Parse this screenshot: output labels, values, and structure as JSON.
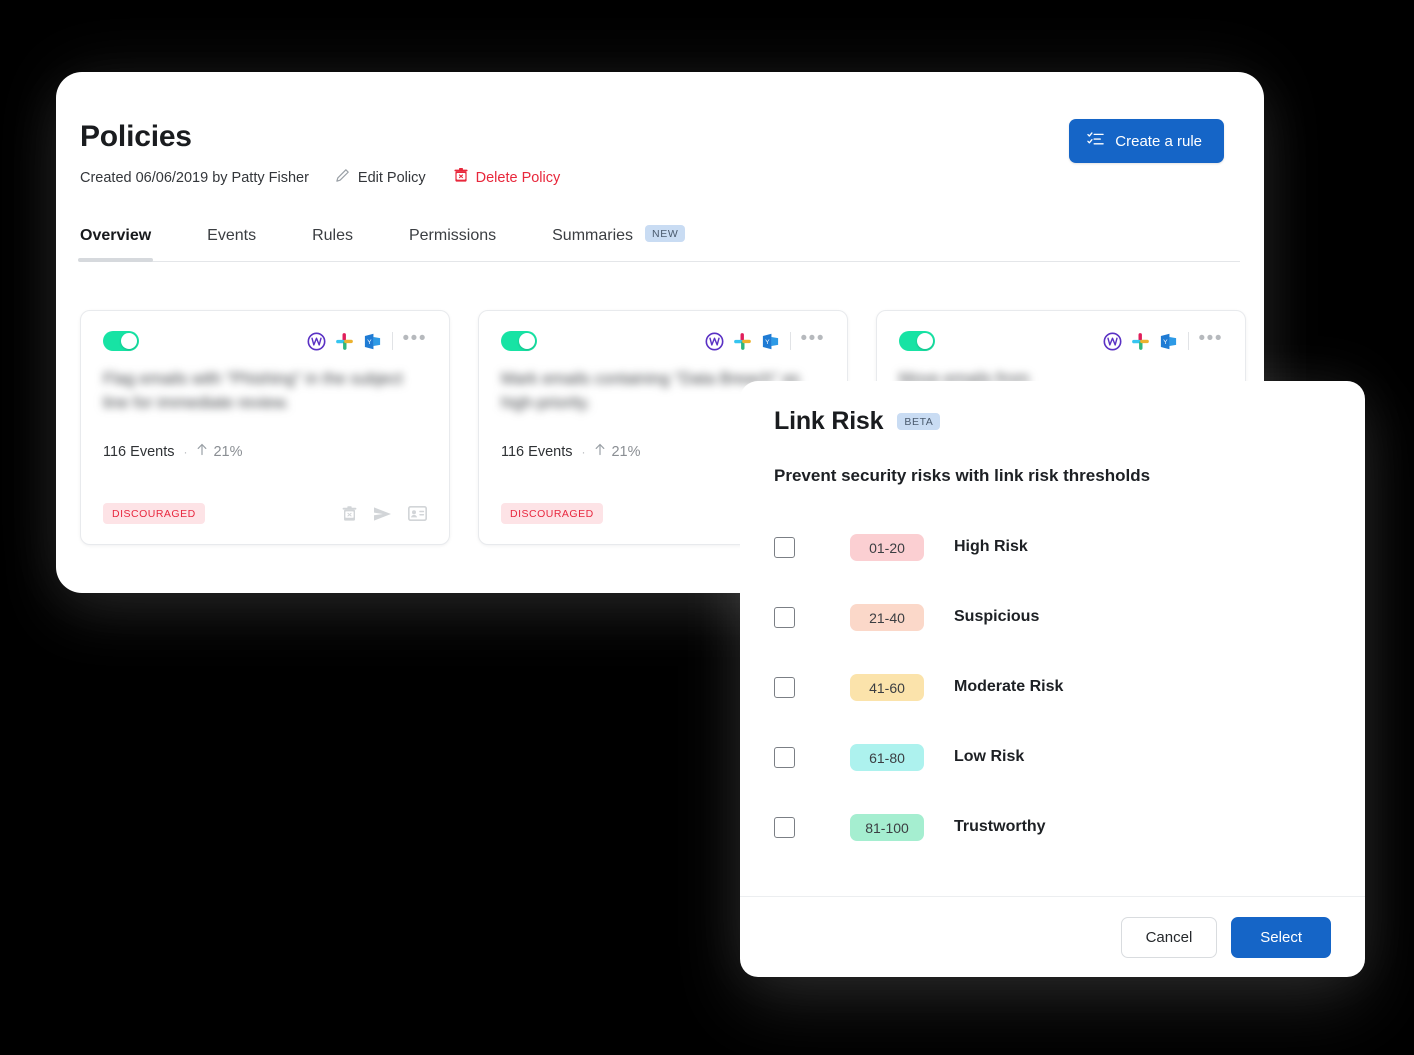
{
  "page": {
    "title": "Policies",
    "created_text": "Created 06/06/2019 by Patty Fisher",
    "edit_label": "Edit Policy",
    "delete_label": "Delete Policy",
    "create_rule_label": "Create a rule",
    "accent_color": "#1565c7",
    "danger_color": "#e8273b"
  },
  "tabs": [
    {
      "label": "Overview",
      "active": true,
      "badge": ""
    },
    {
      "label": "Events",
      "active": false,
      "badge": ""
    },
    {
      "label": "Rules",
      "active": false,
      "badge": ""
    },
    {
      "label": "Permissions",
      "active": false,
      "badge": ""
    },
    {
      "label": "Summaries",
      "active": false,
      "badge": "NEW"
    }
  ],
  "cards": [
    {
      "enabled": true,
      "title": "Flag emails with \"Phishing\" in the subject line for immediate review.",
      "events": "116 Events",
      "separator": "·",
      "delta": "21%",
      "status": "DISCOURAGED",
      "apps": [
        "workplace-icon",
        "slack-icon",
        "yammer-icon"
      ],
      "actions": [
        "trash-icon",
        "send-icon",
        "contact-card-icon"
      ]
    },
    {
      "enabled": true,
      "title": "Mark emails containing \"Data Breach\" as high-priority.",
      "events": "116 Events",
      "separator": "·",
      "delta": "21%",
      "status": "DISCOURAGED",
      "apps": [
        "workplace-icon",
        "slack-icon",
        "yammer-icon"
      ],
      "actions": [
        "trash-icon",
        "send-icon",
        "contact-card-icon"
      ]
    },
    {
      "enabled": true,
      "title": "Move emails from",
      "events": "",
      "separator": "",
      "delta": "",
      "status": "",
      "apps": [
        "workplace-icon",
        "slack-icon",
        "yammer-icon"
      ],
      "actions": []
    }
  ],
  "modal": {
    "title": "Link Risk",
    "badge": "BETA",
    "subtitle": "Prevent security risks with link risk thresholds",
    "rows": [
      {
        "range": "01-20",
        "label": "High Risk",
        "checked": false,
        "bg": "#fbcfd2",
        "fg": "#3b3e42"
      },
      {
        "range": "21-40",
        "label": "Suspicious",
        "checked": false,
        "bg": "#fbd8c9",
        "fg": "#3b3e42"
      },
      {
        "range": "41-60",
        "label": "Moderate Risk",
        "checked": false,
        "bg": "#fbe3ab",
        "fg": "#3b3e42"
      },
      {
        "range": "61-80",
        "label": "Low Risk",
        "checked": false,
        "bg": "#adf2ee",
        "fg": "#3b3e42"
      },
      {
        "range": "81-100",
        "label": "Trustworthy",
        "checked": false,
        "bg": "#a5eed0",
        "fg": "#3b3e42"
      }
    ],
    "cancel_label": "Cancel",
    "select_label": "Select"
  }
}
